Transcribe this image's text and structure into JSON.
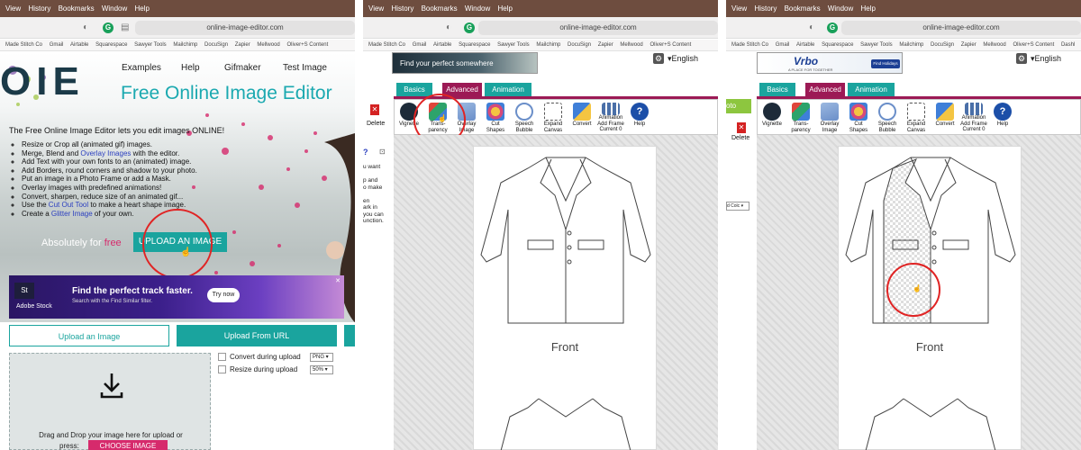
{
  "menu": [
    "View",
    "History",
    "Bookmarks",
    "Window",
    "Help"
  ],
  "url": "online-image-editor.com",
  "bookmarks": [
    "Made Stitch Co",
    "Gmail",
    "Airtable",
    "Squarespace",
    "Sawyer Tools",
    "Mailchimp",
    "DocuSign",
    "Zapier",
    "Mellwood",
    "Oliver+S Content",
    "Dashl"
  ],
  "panel1": {
    "logo": "OIE",
    "nav": [
      "Examples",
      "Help",
      "Gifmaker",
      "Test Image"
    ],
    "heading": "Free Online Image Editor",
    "intro": "The Free Online Image Editor lets you edit images ONLINE!",
    "features": [
      {
        "pre": "Resize or Crop all (animated gif) images.",
        "link": "",
        "post": ""
      },
      {
        "pre": "Merge, Blend and ",
        "link": "Overlay Images",
        "post": " with the editor."
      },
      {
        "pre": "Add Text with your own fonts to an (animated) image.",
        "link": "",
        "post": ""
      },
      {
        "pre": "Add Borders, round corners and shadow to your photo.",
        "link": "",
        "post": ""
      },
      {
        "pre": "Put an image in a Photo Frame or add a Mask.",
        "link": "",
        "post": ""
      },
      {
        "pre": "Overlay images with predefined animations!",
        "link": "",
        "post": ""
      },
      {
        "pre": "Convert, sharpen, reduce size of an animated gif...",
        "link": "",
        "post": ""
      },
      {
        "pre": "Use the ",
        "link": "Cut Out Tool",
        "post": " to make a heart shape image."
      },
      {
        "pre": "Create a ",
        "link": "Glitter Image",
        "post": " of your own."
      }
    ],
    "absolutely": "Absolutely for",
    "free": "free",
    "upload_btn": "UPLOAD AN IMAGE",
    "ad": {
      "brand_badge": "St",
      "brand": "Adobe Stock",
      "title": "Find the perfect track faster.",
      "sub": "Search with the Find Similar filter.",
      "cta": "Try now"
    },
    "tab_upload": "Upload an Image",
    "tab_url": "Upload From URL",
    "drop_text": "Drag and Drop your image here for upload or",
    "press": "press:",
    "choose": "CHOOSE IMAGE",
    "convert_label": "Convert during upload",
    "convert_value": "PNG",
    "resize_label": "Resize during upload",
    "resize_value": "50%"
  },
  "editor": {
    "ad2_text": "Find your perfect somewhere",
    "ad3_brand": "Vrbo",
    "ad3_tag": "A PLACE FOR TOGETHER",
    "ad3_cta": "Find Holidays",
    "language": "English",
    "tabs": [
      "Basics",
      "Advanced",
      "Animation"
    ],
    "tools": [
      {
        "name": "Vignette",
        "label": "Vignette",
        "color": "#1d2b39"
      },
      {
        "name": "transparency",
        "label": "Trans-\nparency",
        "color": "#2da36b"
      },
      {
        "name": "overlay-image",
        "label": "Overlay\nImage",
        "color": "#6b8fc9"
      },
      {
        "name": "cut-shapes",
        "label": "Cut\nShapes",
        "color": "#d64a7a"
      },
      {
        "name": "speech-bubble",
        "label": "Speech\nBubble",
        "color": "#ffffff"
      },
      {
        "name": "expand-canvas",
        "label": "Expand\nCanvas",
        "color": "#9aa3b0"
      },
      {
        "name": "convert",
        "label": "Convert",
        "color": "#3f7fd8"
      },
      {
        "name": "animation",
        "label": "Animation\nAdd Frame\nCurrent 0",
        "color": "#4a6fa8"
      },
      {
        "name": "help",
        "label": "Help",
        "color": "#1c4fa8"
      }
    ],
    "delete": "Delete",
    "front": "Front",
    "side2": [
      "u want",
      "",
      "p and",
      "o make",
      "",
      "en",
      "ark in",
      "you can",
      "unction."
    ],
    "side3_select": "d Colc",
    "side_prefix": "oto"
  }
}
